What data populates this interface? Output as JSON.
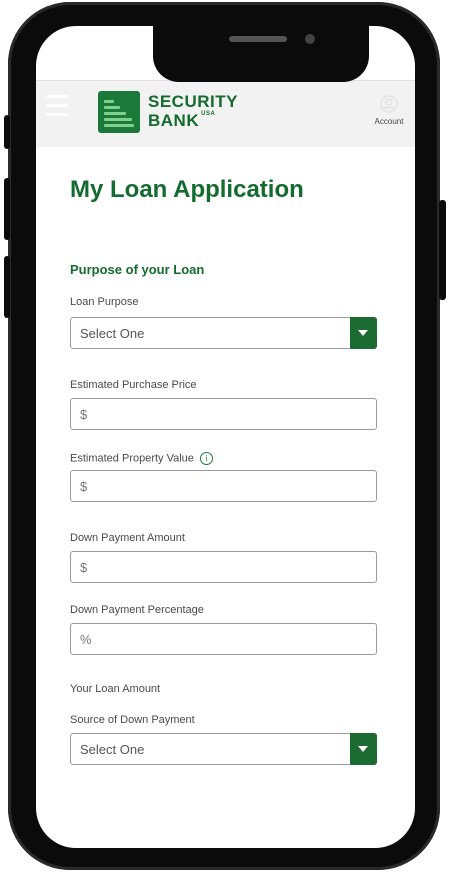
{
  "header": {
    "brand_line1": "SECURITY",
    "brand_line2": "BANK",
    "brand_suffix": "USA",
    "account_label": "Account",
    "brand_color": "#146b2e"
  },
  "page": {
    "title": "My Loan Application",
    "section_title": "Purpose of your Loan"
  },
  "form": {
    "loan_purpose": {
      "label": "Loan Purpose",
      "value": "Select One"
    },
    "purchase_price": {
      "label": "Estimated Purchase Price",
      "placeholder": "$"
    },
    "property_value": {
      "label": "Estimated Property Value",
      "placeholder": "$"
    },
    "down_payment_amount": {
      "label": "Down Payment Amount",
      "placeholder": "$"
    },
    "down_payment_percentage": {
      "label": "Down Payment Percentage",
      "placeholder": "%"
    },
    "loan_amount": {
      "label": "Your Loan Amount"
    },
    "down_payment_source": {
      "label": "Source of Down Payment",
      "value": "Select One"
    }
  },
  "icons": {
    "menu": "hamburger-icon",
    "account": "account-icon",
    "info": "info-icon",
    "dropdown": "chevron-down-icon"
  }
}
